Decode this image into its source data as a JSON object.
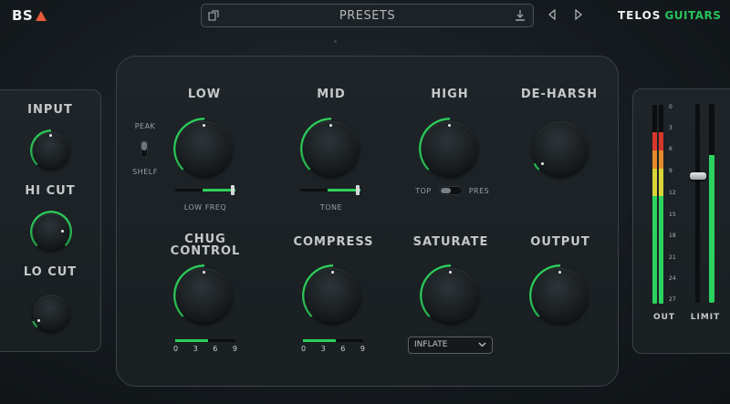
{
  "header": {
    "logo": "BS",
    "presets_label": "PRESETS",
    "brand_primary": "TELOS",
    "brand_secondary": "GUITARS",
    "accent_color": "#2fcf5d",
    "logo_accent_color": "#e85a39"
  },
  "left_panel": {
    "input_label": "INPUT",
    "hicut_label": "HI CUT",
    "locut_label": "LO CUT"
  },
  "eq": {
    "low_label": "LOW",
    "mid_label": "MID",
    "high_label": "HIGH",
    "deharsh_label": "DE-HARSH",
    "peak_label": "PEAK",
    "shelf_label": "SHELF",
    "low_freq_label": "LOW FREQ",
    "tone_label": "TONE",
    "top_label": "TOP",
    "pres_label": "PRES"
  },
  "dynamics": {
    "chug_label_1": "CHUG",
    "chug_label_2": "CONTROL",
    "compress_label": "COMPRESS",
    "saturate_label": "SATURATE",
    "output_label": "OUTPUT",
    "scale_ticks": [
      "0",
      "3",
      "6",
      "9"
    ],
    "saturate_mode": "INFLATE"
  },
  "meters": {
    "out_label": "OUT",
    "limit_label": "LIMIT",
    "scale": [
      "0",
      "3",
      "6",
      "9",
      "12",
      "15",
      "18",
      "21",
      "24",
      "27"
    ]
  }
}
